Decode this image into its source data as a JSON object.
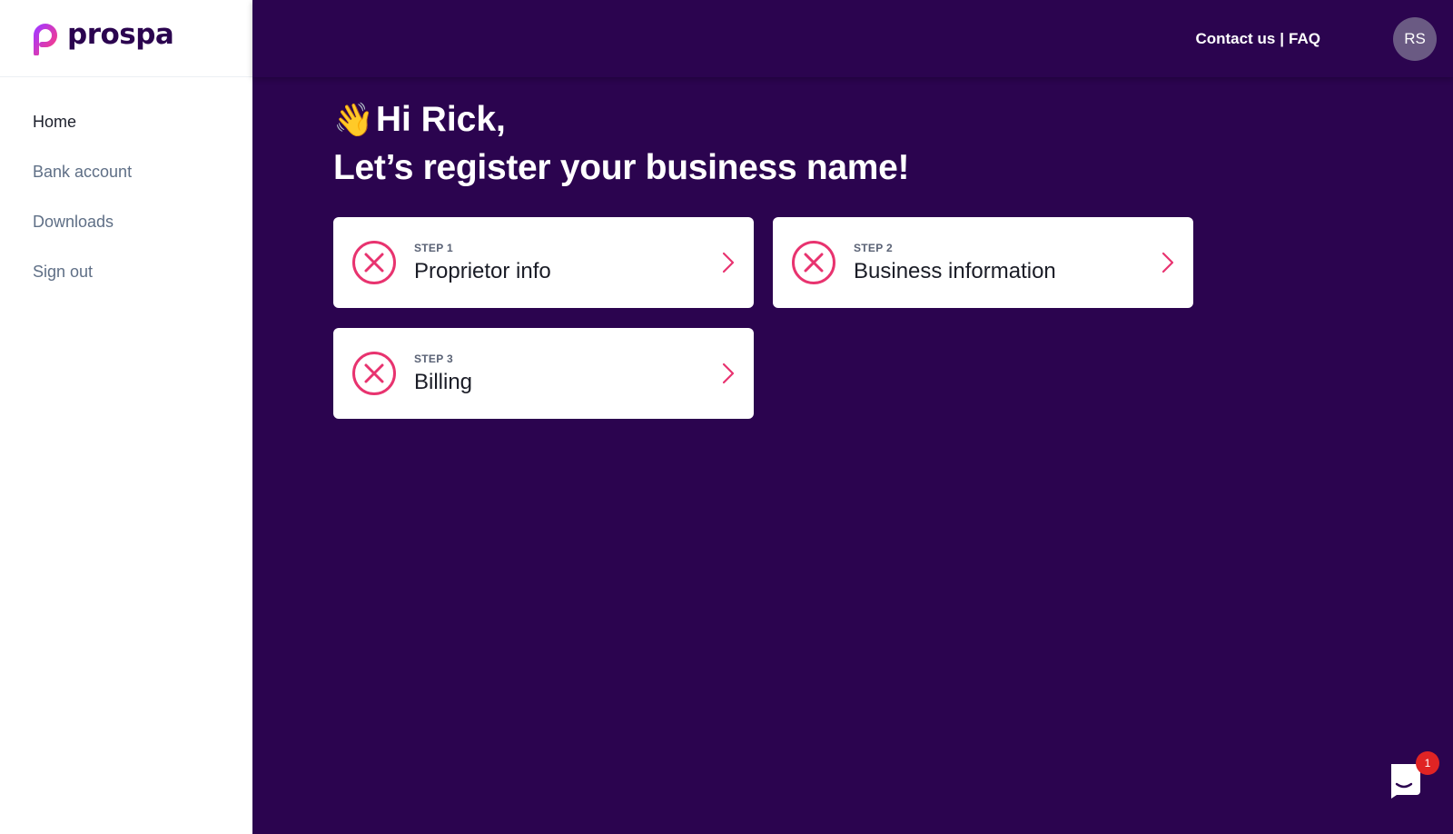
{
  "brand": {
    "name": "prospa",
    "logo_icon": "prospa-logo-icon"
  },
  "sidebar": {
    "items": [
      {
        "label": "Home",
        "active": true
      },
      {
        "label": "Bank account",
        "active": false
      },
      {
        "label": "Downloads",
        "active": false
      },
      {
        "label": "Sign out",
        "active": false
      }
    ]
  },
  "header": {
    "contact_label": "Contact us",
    "separator": "|",
    "faq_label": "FAQ",
    "avatar_initials": "RS"
  },
  "main": {
    "greeting": "Hi Rick,",
    "wave_emoji": "👋",
    "headline": "Let’s register your business name!",
    "steps": [
      {
        "label": "STEP 1",
        "title": "Proprietor info",
        "status": "incomplete"
      },
      {
        "label": "STEP 2",
        "title": "Business information",
        "status": "incomplete"
      },
      {
        "label": "STEP 3",
        "title": "Billing",
        "status": "incomplete"
      }
    ]
  },
  "chat": {
    "badge_count": "1",
    "icon": "chat-icon"
  },
  "colors": {
    "background": "#2b044f",
    "accent": "#e8336f",
    "sidebar_bg": "#ffffff",
    "badge": "#e02424"
  }
}
